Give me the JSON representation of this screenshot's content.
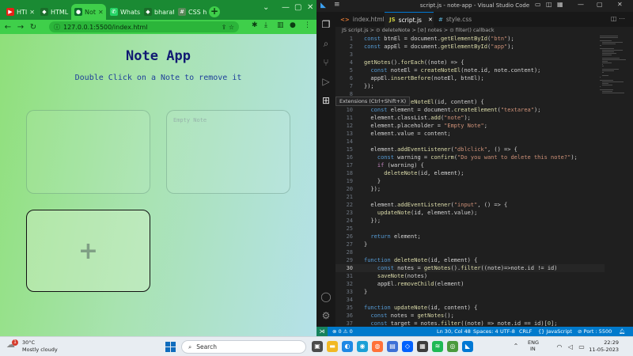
{
  "browser": {
    "tabs": [
      {
        "label": "HTI",
        "favicon": "youtube-icon",
        "color": "#e62117"
      },
      {
        "label": "HTML",
        "favicon": "shield-icon",
        "color": "#1a6d2a"
      },
      {
        "label": "Not",
        "favicon": "globe-icon",
        "color": "#0b6e2a"
      },
      {
        "label": "Whats",
        "favicon": "whatsapp-icon",
        "color": "#25d366"
      },
      {
        "label": "bharat",
        "favicon": "shield-icon",
        "color": "#1a6d2a"
      },
      {
        "label": "CSS hu",
        "favicon": "css-icon",
        "color": "#5a8a5a"
      }
    ],
    "url": "127.0.0.1:5500/index.html"
  },
  "app": {
    "title": "Note App",
    "subtitle": "Double Click on a Note to remove it",
    "notes": [
      {
        "value": "",
        "placeholder": ""
      },
      {
        "value": "",
        "placeholder": "Empty Note"
      }
    ],
    "add_label": "+"
  },
  "vscode": {
    "window_title": "script.js - note-app - Visual Studio Code",
    "tabs": [
      {
        "label": "index.html",
        "icon": "<>",
        "color": "#e37933"
      },
      {
        "label": "script.js",
        "icon": "JS",
        "color": "#cbcb41"
      },
      {
        "label": "style.css",
        "icon": "#",
        "color": "#519aba"
      }
    ],
    "breadcrumb": "JS script.js > ⊙ deleteNote > [⊘] notes > ⊙ filter() callback",
    "tooltip": "Extensions (Ctrl+Shift+X)",
    "lines": [
      {
        "n": "1",
        "t": "const btnEl = document.getElementById(\"btn\");"
      },
      {
        "n": "2",
        "t": "const appEl = document.getElementById(\"app\");"
      },
      {
        "n": "3",
        "t": ""
      },
      {
        "n": "4",
        "t": "getNotes().forEach((note) => {"
      },
      {
        "n": "5",
        "t": "  const noteEl = createNoteEl(note.id, note.content);"
      },
      {
        "n": "6",
        "t": "  appEl.insertBefore(noteEl, btnEl);"
      },
      {
        "n": "7",
        "t": "});"
      },
      {
        "n": "8",
        "t": ""
      },
      {
        "n": "9",
        "t": "function createNoteEl(id, content) {"
      },
      {
        "n": "10",
        "t": "  const element = document.createElement(\"textarea\");"
      },
      {
        "n": "11",
        "t": "  element.classList.add(\"note\");"
      },
      {
        "n": "12",
        "t": "  element.placeholder = \"Empty Note\";"
      },
      {
        "n": "13",
        "t": "  element.value = content;"
      },
      {
        "n": "14",
        "t": ""
      },
      {
        "n": "15",
        "t": "  element.addEventListener(\"dblclick\", () => {"
      },
      {
        "n": "16",
        "t": "    const warning = confirm(\"Do you want to delete this note?\");"
      },
      {
        "n": "17",
        "t": "    if (warning) {"
      },
      {
        "n": "18",
        "t": "      deleteNote(id, element);"
      },
      {
        "n": "19",
        "t": "    }"
      },
      {
        "n": "20",
        "t": "  });"
      },
      {
        "n": "21",
        "t": ""
      },
      {
        "n": "22",
        "t": "  element.addEventListener(\"input\", () => {"
      },
      {
        "n": "23",
        "t": "    updateNote(id, element.value);"
      },
      {
        "n": "24",
        "t": "  });"
      },
      {
        "n": "25",
        "t": ""
      },
      {
        "n": "26",
        "t": "  return element;"
      },
      {
        "n": "27",
        "t": "}"
      },
      {
        "n": "28",
        "t": ""
      },
      {
        "n": "29",
        "t": "function deleteNote(id, element) {"
      },
      {
        "n": "30",
        "t": "    const notes = getNotes().filter((note)=>note.id != id)"
      },
      {
        "n": "31",
        "t": "    saveNote(notes)"
      },
      {
        "n": "32",
        "t": "    appEl.removeChild(element)"
      },
      {
        "n": "33",
        "t": "}"
      },
      {
        "n": "34",
        "t": ""
      },
      {
        "n": "35",
        "t": "function updateNote(id, content) {"
      },
      {
        "n": "36",
        "t": "  const notes = getNotes();"
      },
      {
        "n": "37",
        "t": "  const target = notes.filter((note) => note.id == id)[0];"
      }
    ],
    "status": {
      "errors": "⊗ 0 ⚠ 0",
      "position": "Ln 30, Col 48",
      "spaces": "Spaces: 4",
      "encoding": "UTF-8",
      "eol": "CRLF",
      "language": "{} JavaScript",
      "port": "⊘ Port : 5500"
    }
  },
  "taskbar": {
    "weather_temp": "30°C",
    "weather_desc": "Mostly cloudy",
    "weather_badge": "1",
    "search_placeholder": "Search",
    "lang_1": "ENG",
    "lang_2": "IN",
    "time": "22:29",
    "date": "11-05-2023"
  }
}
